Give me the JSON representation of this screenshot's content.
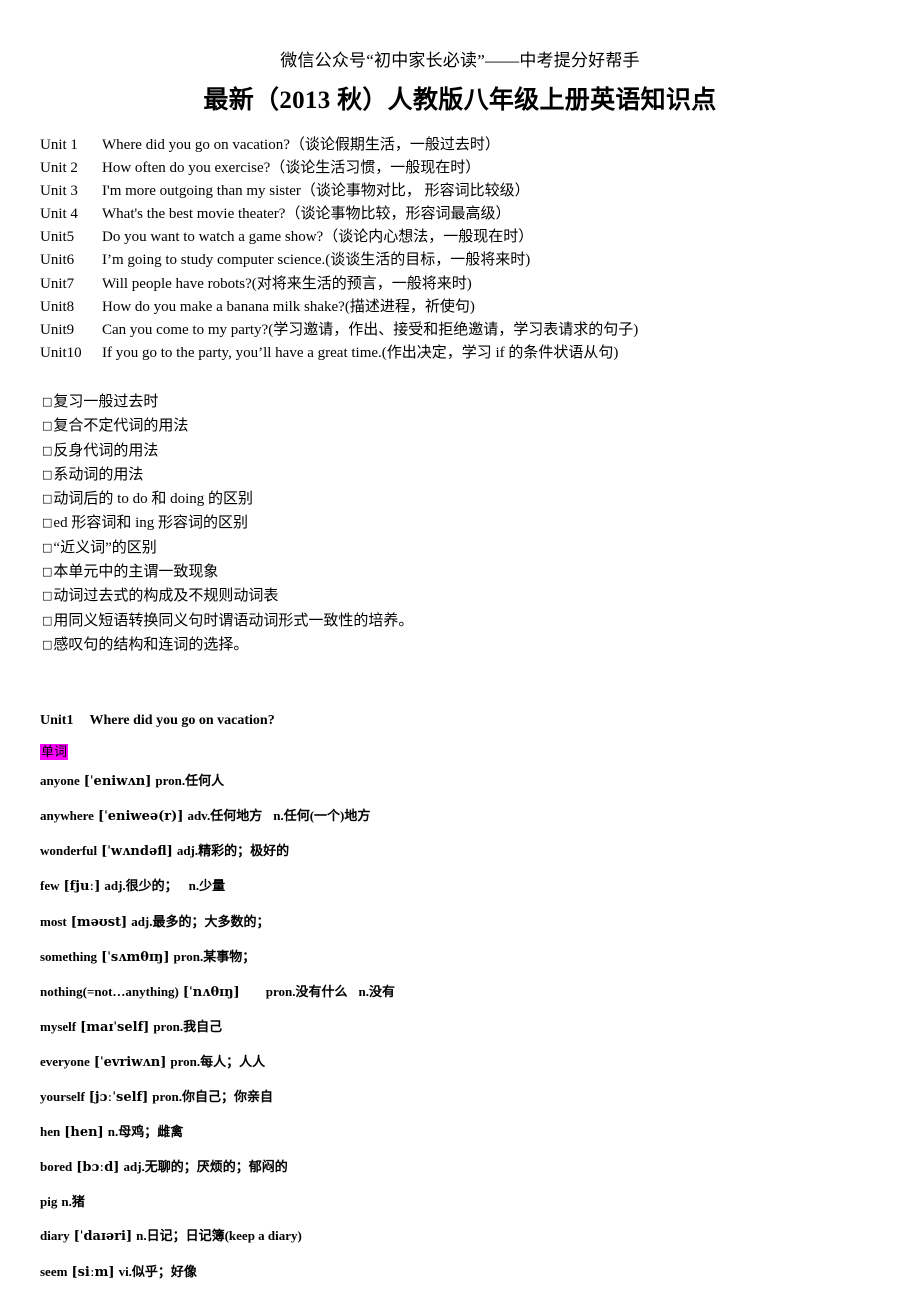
{
  "header": {
    "banner": "微信公众号“初中家长必读”——中考提分好帮手",
    "title": "最新（2013 秋）人教版八年级上册英语知识点"
  },
  "unit_overview": {
    "items": [
      {
        "label": "Unit 1",
        "text": "Where did you go on vacation?（谈论假期生活，一般过去时）"
      },
      {
        "label": "Unit 2",
        "text": "How often do you exercise?（谈论生活习惯，一般现在时）"
      },
      {
        "label": "Unit 3",
        "text": "I'm more outgoing than my sister（谈论事物对比，  形容词比较级）"
      },
      {
        "label": "Unit 4",
        "text": "What's the best movie theater?（谈论事物比较，形容词最高级）"
      },
      {
        "label": "Unit5",
        "text": "Do you want to watch a game show?（谈论内心想法，一般现在时）"
      },
      {
        "label": "Unit6",
        "text": "I’m going to study computer science.(谈谈生活的目标，一般将来时)"
      },
      {
        "label": "Unit7",
        "text": "Will people have robots?(对将来生活的预言，一般将来时)"
      },
      {
        "label": "Unit8",
        "text": "How do you make a banana milk shake?(描述进程，祈使句)"
      },
      {
        "label": "Unit9",
        "text": "Can you come to my party?(学习邀请，作出、接受和拒绝邀请，学习表请求的句子)"
      },
      {
        "label": "Unit10",
        "text": "If you go to the party, you’ll have a great time.(作出决定，学习 if 的条件状语从句)"
      }
    ]
  },
  "goals": {
    "bullet_glyph": "□",
    "items": [
      "复习一般过去时",
      "复合不定代词的用法",
      "反身代词的用法",
      "系动词的用法",
      "动词后的 to do 和 doing  的区别",
      "ed 形容词和 ing 形容词的区别",
      "“近义词”的区别",
      "本单元中的主谓一致现象",
      "动词过去式的构成及不规则动词表",
      "用同义短语转换同义句时谓语动词形式一致性的培养。",
      "感叹句的结构和连词的选择。"
    ]
  },
  "unit1": {
    "label": "Unit1",
    "title": "Where did you go on vacation?",
    "keyword_badge": "单词",
    "keyword_badge_color": "#ff00ff",
    "vocabulary": [
      {
        "word": "anyone",
        "ipa": "[ˈeniwʌn]",
        "def": "pron.任何人",
        "def2": ""
      },
      {
        "word": "anywhere",
        "ipa": "[ˈeniweə(r)]",
        "def": "adv.任何地方",
        "def2": "n.任何(一个)地方"
      },
      {
        "word": "wonderful",
        "ipa": "[ˈwʌndəfl]",
        "def": "adj.精彩的；极好的",
        "def2": ""
      },
      {
        "word": "few",
        "ipa": "[fjuː]",
        "def": "adj.很少的；",
        "def2": "n.少量"
      },
      {
        "word": "most",
        "ipa": "[məʊst]",
        "def": "adj.最多的；大多数的；",
        "def2": ""
      },
      {
        "word": "something",
        "ipa": "[ˈsʌmθɪŋ]",
        "def": "pron.某事物；",
        "def2": ""
      },
      {
        "word": "nothing(=not…anything)",
        "ipa": "[ˈnʌθɪŋ]",
        "def": "pron.没有什么",
        "def2": "n.没有",
        "wide_gap": true
      },
      {
        "word": "myself",
        "ipa": "[maɪˈself]",
        "def": "pron.我自己",
        "def2": ""
      },
      {
        "word": "everyone",
        "ipa": "[ˈevriwʌn]",
        "def": "pron.每人；人人",
        "def2": ""
      },
      {
        "word": "yourself",
        "ipa": "[jɔːˈself]",
        "def": "pron.你自己；你亲自",
        "def2": ""
      },
      {
        "word": "hen",
        "ipa": "[hen]",
        "def": "n.母鸡；雌禽",
        "def2": ""
      },
      {
        "word": "bored",
        "ipa": "[bɔːd]",
        "def": "adj.无聊的；厌烦的；郁闷的",
        "def2": ""
      },
      {
        "word": "pig",
        "ipa": "",
        "def": "n.猪",
        "def2": ""
      },
      {
        "word": "diary",
        "ipa": "[ˈdaɪəri]",
        "def": "n.日记；日记簿(keep a diary)",
        "def2": ""
      },
      {
        "word": "seem",
        "ipa": "[siːm]",
        "def": "vi.似乎；好像",
        "def2": ""
      }
    ]
  }
}
